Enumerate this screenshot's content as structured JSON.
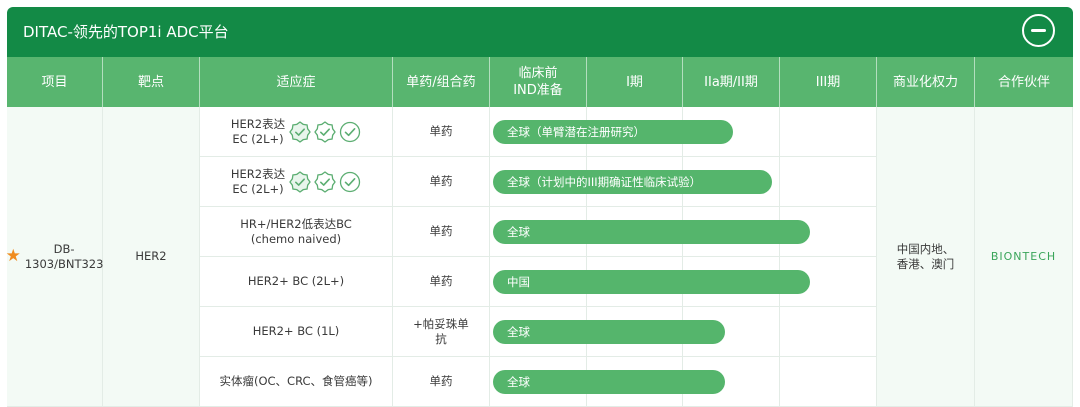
{
  "title": "DITAC-领先的TOP1i ADC平台",
  "header": {
    "columns": [
      "项目",
      "靶点",
      "适应症",
      "单药/组合药",
      "临床前\nIND准备",
      "I期",
      "IIa期/II期",
      "III期",
      "商业化权力",
      "合作伙伴"
    ]
  },
  "project": {
    "name": "DB-\n1303/BNT323",
    "target": "HER2",
    "rights": "中国内地、\n香港、澳门",
    "partner": "BIONTECH"
  },
  "rows": [
    {
      "indication": "HER2表达\nEC (2L+)",
      "regimen": "单药",
      "bar_label": "全球（单臂潜在注册研究）",
      "progress": 0.62,
      "badges": [
        "check-badge-filled-icon",
        "check-badge-outline-icon",
        "check-circle-icon"
      ]
    },
    {
      "indication": "HER2表达\nEC (2L+)",
      "regimen": "单药",
      "bar_label": "全球（计划中的III期确证性临床试验）",
      "progress": 0.72,
      "badges": [
        "check-badge-filled-icon",
        "check-badge-outline-icon",
        "check-circle-icon"
      ]
    },
    {
      "indication": "HR+/HER2低表达BC\n(chemo naived)",
      "regimen": "单药",
      "bar_label": "全球",
      "progress": 0.82
    },
    {
      "indication": "HER2+ BC (2L+)",
      "regimen": "单药",
      "bar_label": "中国",
      "progress": 0.82
    },
    {
      "indication": "HER2+ BC (1L)",
      "regimen": "+帕妥珠单\n抗",
      "bar_label": "全球",
      "progress": 0.6
    },
    {
      "indication": "实体瘤(OC、CRC、食管癌等)",
      "regimen": "单药",
      "bar_label": "全球",
      "progress": 0.6
    }
  ],
  "colors": {
    "title_bg": "#138a46",
    "header_bg": "#58b56f",
    "bar": "#55b56c",
    "star": "#f08c1f"
  }
}
